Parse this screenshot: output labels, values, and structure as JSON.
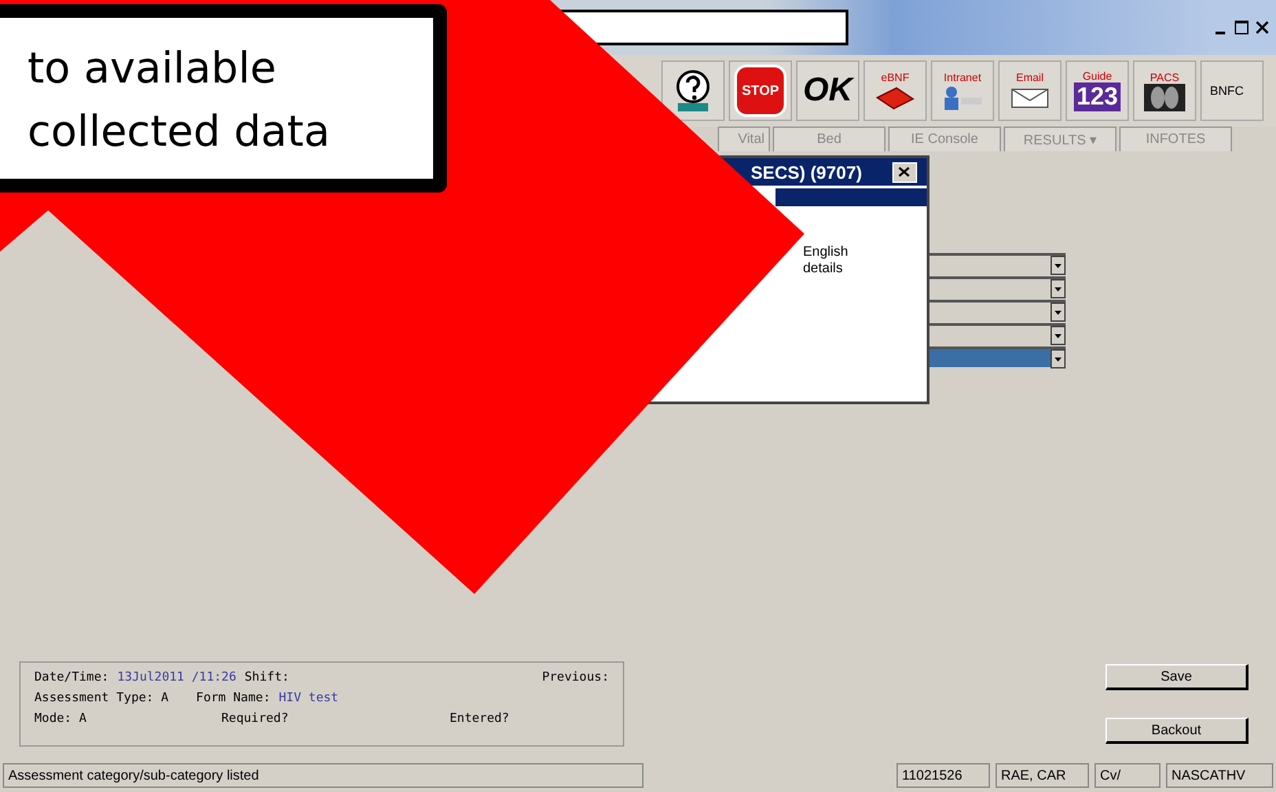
{
  "callout": {
    "lines": [
      "to available",
      "collected data"
    ]
  },
  "toolbar": [
    {
      "kind": "help"
    },
    {
      "kind": "stop",
      "label": "STOP"
    },
    {
      "kind": "ok",
      "label": "OK"
    },
    {
      "kind": "book",
      "label": "eBNF"
    },
    {
      "kind": "intranet",
      "label": "Intranet"
    },
    {
      "kind": "email",
      "label": "Email"
    },
    {
      "kind": "guide",
      "label": "Guide",
      "sub": "123"
    },
    {
      "kind": "xray",
      "label": "PACS"
    },
    {
      "kind": "text",
      "label": "BNFC"
    }
  ],
  "tabs": [
    "Vital",
    "Bed",
    "IE Console",
    "RESULTS ▾",
    "INFOTES"
  ],
  "dialog": {
    "title": "SECS) (9707)",
    "lines": [
      "English",
      "details"
    ]
  },
  "combos": [
    {
      "selected": false
    },
    {
      "selected": false
    },
    {
      "selected": false
    },
    {
      "selected": false
    },
    {
      "selected": true
    }
  ],
  "info": {
    "datetime_label": "Date/Time:",
    "datetime": "13Jul2011 /11:26",
    "shift": "Shift:",
    "previous": "Previous:",
    "type": "Assessment Type: A",
    "form_label": "Form Name:",
    "form": "HIV test",
    "mode": "Mode: A",
    "required": "Required?",
    "entered": "Entered?"
  },
  "buttons": [
    "Save",
    "Backout"
  ],
  "status": [
    "Assessment category/sub-category listed",
    "11021526",
    "RAE, CAR",
    "Cv/",
    "NASCATHV"
  ]
}
